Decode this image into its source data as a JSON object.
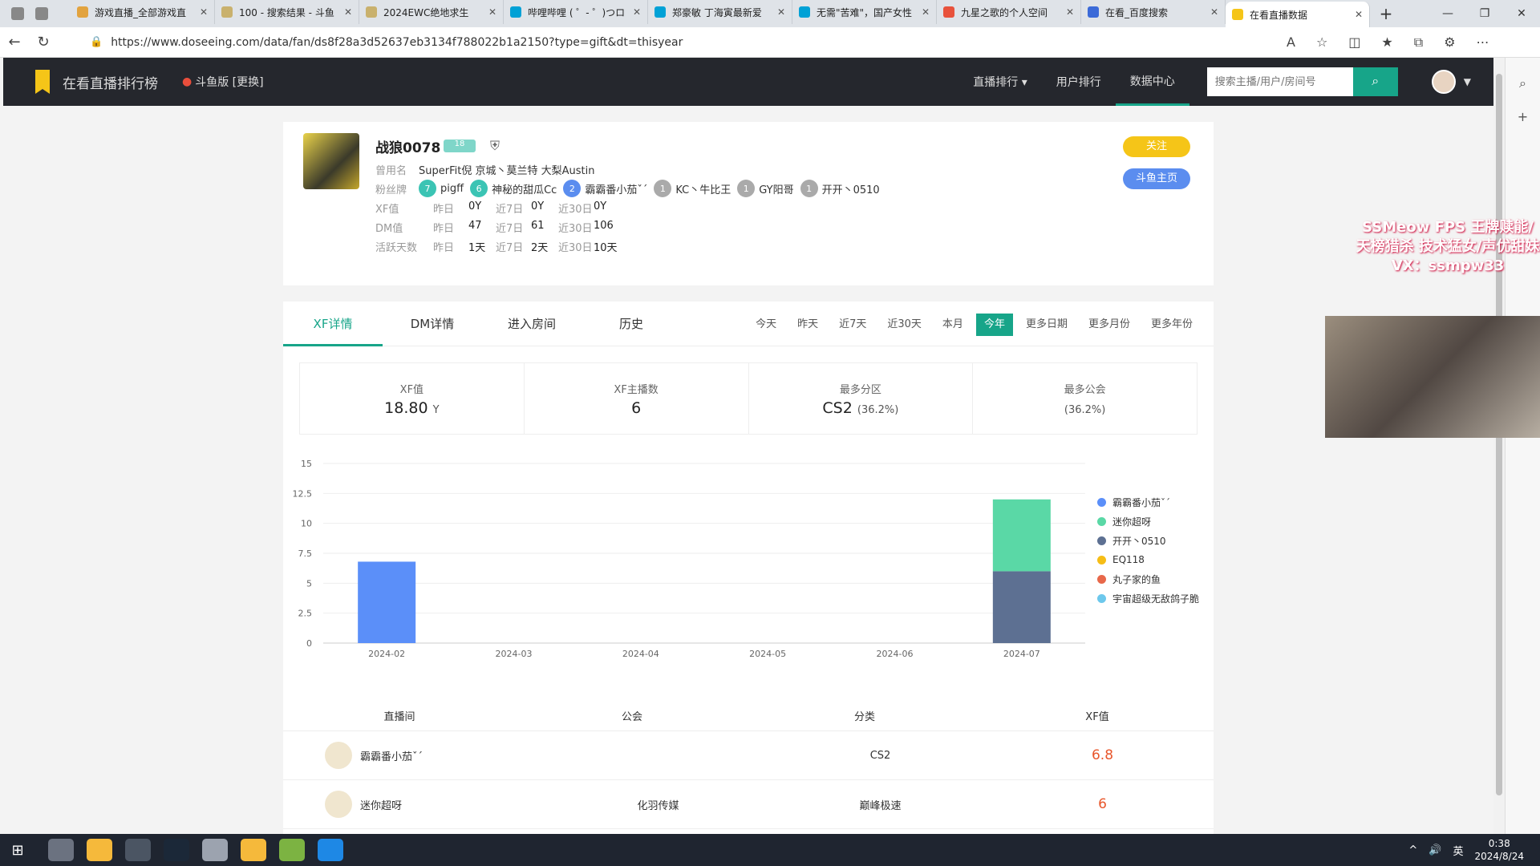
{
  "browser": {
    "tabs": [
      {
        "title": "游戏直播_全部游戏直",
        "color": "#e2a33f"
      },
      {
        "title": "100 - 搜索结果 - 斗鱼",
        "color": "#c9b16d"
      },
      {
        "title": "2024EWC绝地求生",
        "color": "#c9b16d"
      },
      {
        "title": "哔哩哔哩 ( ゜- ゜)つロ",
        "color": "#00a1d6"
      },
      {
        "title": "郑豪敏 丁海寅最新爱",
        "color": "#00a1d6"
      },
      {
        "title": "无需\"苦难\"，国产女性",
        "color": "#00a1d6"
      },
      {
        "title": "九星之歌的个人空间",
        "color": "#e8523c"
      },
      {
        "title": "在看_百度搜索",
        "color": "#3b6ad8"
      },
      {
        "title": "在看直播数据",
        "color": "#f5c518"
      }
    ],
    "url": "https://www.doseeing.com/data/fan/ds8f28a3d52637eb3134f788022b1a2150?type=gift&dt=thisyear"
  },
  "site": {
    "name": "在看直播排行榜",
    "region": "斗鱼版 [更换]",
    "menu": [
      "直播排行 ▾",
      "用户排行",
      "数据中心"
    ],
    "search_placeholder": "搜索主播/用户/房间号"
  },
  "profile": {
    "name": "战狼0078",
    "level_badge": "18",
    "aliases_label": "曾用名",
    "aliases": "SuperFit倪   京城丶莫兰特   大梨Austin",
    "fans_label": "粉丝牌",
    "fans": [
      {
        "lv": "7",
        "name": "pigff",
        "color": "#3bc4b4"
      },
      {
        "lv": "6",
        "name": "神秘的甜瓜Cc",
        "color": "#3bc4b4"
      },
      {
        "lv": "2",
        "name": "霸霸番小茄ˇˊ",
        "color": "#5b8def"
      },
      {
        "lv": "1",
        "name": "KC丶牛比王",
        "color": "#aaaaaa"
      },
      {
        "lv": "1",
        "name": "GY阳哥",
        "color": "#aaaaaa"
      },
      {
        "lv": "1",
        "name": "开开丶0510",
        "color": "#aaaaaa"
      }
    ],
    "stats": [
      {
        "key": "XF值",
        "d1": "0Y",
        "d7": "0Y",
        "d30": "0Y"
      },
      {
        "key": "DM值",
        "d1": "47",
        "d7": "61",
        "d30": "106"
      },
      {
        "key": "活跃天数",
        "d1": "1天",
        "d7": "2天",
        "d30": "10天"
      }
    ],
    "period_labels": [
      "昨日",
      "近7日",
      "近30日"
    ],
    "follow_label": "关注",
    "home_label": "斗鱼主页"
  },
  "panel": {
    "tabs": [
      "XF详情",
      "DM详情",
      "进入房间",
      "历史"
    ],
    "dates": [
      "今天",
      "昨天",
      "近7天",
      "近30天",
      "本月",
      "今年",
      "更多日期",
      "更多月份",
      "更多年份"
    ],
    "summary": [
      {
        "cap": "XF值",
        "val": "18.80",
        "unit": "Y"
      },
      {
        "cap": "XF主播数",
        "val": "6",
        "unit": ""
      },
      {
        "cap": "最多分区",
        "val": "CS2",
        "unit": "(36.2%)"
      },
      {
        "cap": "最多公会",
        "val": "",
        "unit": "(36.2%)"
      }
    ],
    "table_headers": [
      "直播间",
      "公会",
      "分类",
      "XF值"
    ],
    "rows": [
      {
        "room": "霸霸番小茄ˇˊ",
        "guild": "",
        "cat": "CS2",
        "xf": "6.8"
      },
      {
        "room": "迷你超呀",
        "guild": "化羽传媒",
        "cat": "巅峰极速",
        "xf": "6"
      }
    ]
  },
  "chart_data": {
    "type": "bar",
    "stacked": true,
    "categories": [
      "2024-02",
      "2024-03",
      "2024-04",
      "2024-05",
      "2024-06",
      "2024-07"
    ],
    "ylim": [
      0,
      15
    ],
    "yticks": [
      "0",
      "2.5",
      "5",
      "7.5",
      "10",
      "12.5",
      "15"
    ],
    "series": [
      {
        "name": "霸霸番小茄ˇˊ",
        "color": "#5b8ff9",
        "values": [
          6.8,
          0,
          0,
          0,
          0,
          0
        ]
      },
      {
        "name": "开开丶0510",
        "color": "#5d7092",
        "values": [
          0,
          0,
          0,
          0,
          0,
          6
        ]
      },
      {
        "name": "迷你超呀",
        "color": "#5ad8a6",
        "values": [
          0,
          0,
          0,
          0,
          0,
          6
        ]
      },
      {
        "name": "EQ118",
        "color": "#f6bd16",
        "values": [
          0,
          0,
          0,
          0,
          0,
          0
        ]
      },
      {
        "name": "丸子家的鱼",
        "color": "#e8684a",
        "values": [
          0,
          0,
          0,
          0,
          0,
          0
        ]
      },
      {
        "name": "宇宙超级无敌鸽子脆",
        "color": "#6dc8ec",
        "values": [
          0,
          0,
          0,
          0,
          0,
          0
        ]
      }
    ],
    "legend_order": [
      0,
      2,
      1,
      3,
      4,
      5
    ],
    "legend_position": "right"
  },
  "overlay": {
    "stream_text": "SSMeow FPS 王牌赎能/天榜猎杀 技术猛女/声优甜妹 VX：ssmpw33"
  },
  "taskbar": {
    "time": "0:38",
    "date": "2024/8/24",
    "ime": "英"
  }
}
